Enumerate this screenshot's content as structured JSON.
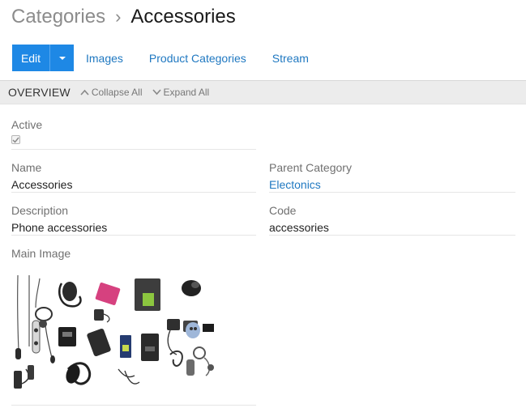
{
  "breadcrumb": {
    "parent": "Categories",
    "separator": "›",
    "current": "Accessories"
  },
  "toolbar": {
    "edit_label": "Edit",
    "tabs": [
      "Images",
      "Product Categories",
      "Stream"
    ]
  },
  "overview": {
    "title": "OVERVIEW",
    "collapse_label": "Collapse All",
    "expand_label": "Expand All"
  },
  "fields": {
    "active": {
      "label": "Active",
      "checked": true
    },
    "name": {
      "label": "Name",
      "value": "Accessories"
    },
    "parent_category": {
      "label": "Parent Category",
      "value": "Electonics"
    },
    "description": {
      "label": "Description",
      "value": "Phone accessories"
    },
    "code": {
      "label": "Code",
      "value": "accessories"
    },
    "main_image": {
      "label": "Main Image"
    }
  },
  "colors": {
    "primary": "#1e88e5",
    "link": "#1f78c1",
    "bar": "#ececec"
  }
}
